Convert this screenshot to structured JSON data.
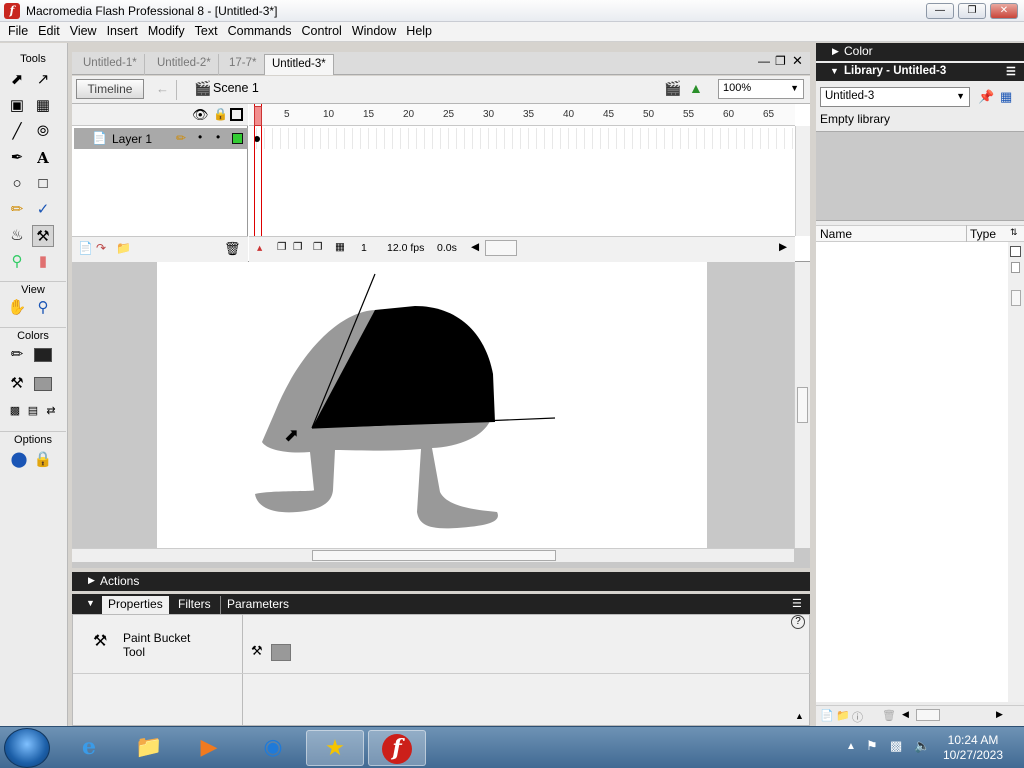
{
  "window": {
    "title": "Macromedia Flash Professional 8 - [Untitled-3*]",
    "app_icon": "flash-icon"
  },
  "menu": [
    "File",
    "Edit",
    "View",
    "Insert",
    "Modify",
    "Text",
    "Commands",
    "Control",
    "Window",
    "Help"
  ],
  "tools": {
    "title": "Tools",
    "view_label": "View",
    "colors_label": "Colors",
    "options_label": "Options",
    "selected": "paint-bucket-tool"
  },
  "doc_tabs": [
    "Untitled-1*",
    "Untitled-2*",
    "17-7*",
    "Untitled-3*"
  ],
  "editbar": {
    "timeline_label": "Timeline",
    "scene_label": "Scene 1",
    "zoom_value": "100%"
  },
  "timeline": {
    "layer_name": "Layer 1",
    "ruler": [
      "1",
      "5",
      "10",
      "15",
      "20",
      "25",
      "30",
      "35",
      "40",
      "45",
      "50",
      "55",
      "60",
      "65"
    ],
    "current_frame": "1",
    "fps": "12.0 fps",
    "elapsed": "0.0s"
  },
  "panels": {
    "actions_label": "Actions",
    "properties_tab": "Properties",
    "filters_tab": "Filters",
    "parameters_tab": "Parameters",
    "tool_name_line1": "Paint Bucket",
    "tool_name_line2": "Tool",
    "help_glyph": "?"
  },
  "right": {
    "color_label": "Color",
    "library_label": "Library - Untitled-3",
    "library_select": "Untitled-3",
    "empty_text": "Empty library",
    "col_name": "Name",
    "col_type": "Type"
  },
  "taskbar": {
    "time": "10:24 AM",
    "date": "10/27/2023"
  },
  "colors": {
    "fill": "#999999",
    "stroke": "#000000",
    "accent": "#cc1f1a"
  }
}
